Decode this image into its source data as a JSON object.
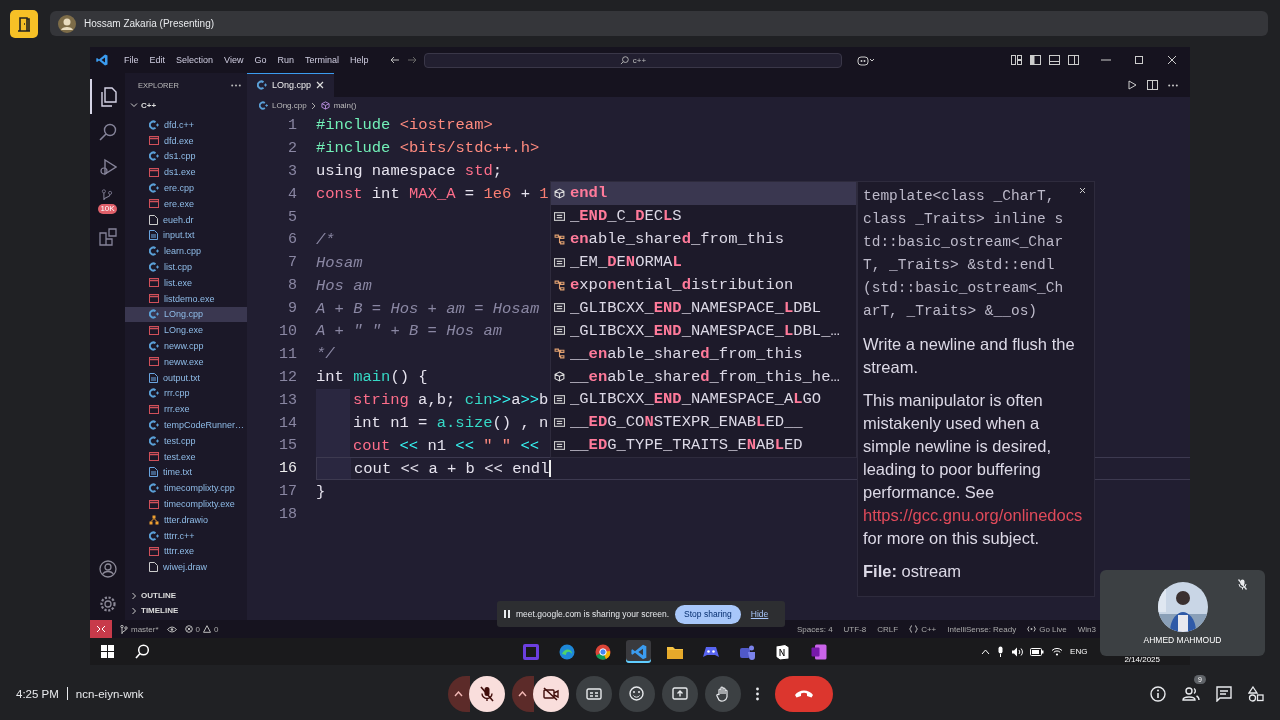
{
  "meet": {
    "presenter": "Hossam Zakaria (Presenting)",
    "time": "4:25 PM",
    "meeting_code": "ncn-eiyn-wnk",
    "controls": [
      {
        "kind": "caret"
      },
      {
        "kind": "mic",
        "on": false
      },
      {
        "kind": "caret"
      },
      {
        "kind": "camera",
        "on": false
      },
      {
        "kind": "captions"
      },
      {
        "kind": "emoji"
      },
      {
        "kind": "present"
      },
      {
        "kind": "hand"
      },
      {
        "kind": "more"
      },
      {
        "kind": "end"
      }
    ],
    "side_controls": [
      {
        "kind": "info"
      },
      {
        "kind": "people",
        "count": "9"
      },
      {
        "kind": "chat"
      },
      {
        "kind": "activities"
      }
    ]
  },
  "tile": {
    "name": "AHMED MAHMOUD",
    "muted": true
  },
  "banner": {
    "message": "meet.google.com is sharing your screen.",
    "stop": "Stop sharing",
    "hide": "Hide"
  },
  "vscode": {
    "menu": [
      "File",
      "Edit",
      "Selection",
      "View",
      "Go",
      "Run",
      "Terminal",
      "Help"
    ],
    "search": "c++",
    "activity": [
      {
        "kind": "files",
        "selected": true
      },
      {
        "kind": "search",
        "selected": false
      },
      {
        "kind": "debug",
        "selected": false
      },
      {
        "kind": "branch",
        "selected": false,
        "badge": "10K"
      },
      {
        "kind": "extensions",
        "selected": false
      }
    ],
    "explorer": {
      "title": "EXPLORER",
      "folder": "C++",
      "expanded": true,
      "files": [
        {
          "name": "dfd.c++",
          "kind": "cpp",
          "selected": false
        },
        {
          "name": "dfd.exe",
          "kind": "exe",
          "selected": false
        },
        {
          "name": "ds1.cpp",
          "kind": "cpp",
          "selected": false
        },
        {
          "name": "ds1.exe",
          "kind": "exe",
          "selected": false
        },
        {
          "name": "ere.cpp",
          "kind": "cpp",
          "selected": false
        },
        {
          "name": "ere.exe",
          "kind": "exe",
          "selected": false
        },
        {
          "name": "eueh.dr",
          "kind": "file",
          "selected": false
        },
        {
          "name": "input.txt",
          "kind": "txt",
          "selected": false
        },
        {
          "name": "learn.cpp",
          "kind": "cpp",
          "selected": false
        },
        {
          "name": "list.cpp",
          "kind": "cpp",
          "selected": false
        },
        {
          "name": "list.exe",
          "kind": "exe",
          "selected": false
        },
        {
          "name": "listdemo.exe",
          "kind": "exe",
          "selected": false
        },
        {
          "name": "LOng.cpp",
          "kind": "cpp",
          "selected": true
        },
        {
          "name": "LOng.exe",
          "kind": "exe",
          "selected": false
        },
        {
          "name": "neww.cpp",
          "kind": "cpp",
          "selected": false
        },
        {
          "name": "neww.exe",
          "kind": "exe",
          "selected": false
        },
        {
          "name": "output.txt",
          "kind": "txt",
          "selected": false
        },
        {
          "name": "rrr.cpp",
          "kind": "cpp",
          "selected": false
        },
        {
          "name": "rrr.exe",
          "kind": "exe",
          "selected": false
        },
        {
          "name": "tempCodeRunner…",
          "kind": "cpp",
          "selected": false
        },
        {
          "name": "test.cpp",
          "kind": "cpp",
          "selected": false
        },
        {
          "name": "test.exe",
          "kind": "exe",
          "selected": false
        },
        {
          "name": "time.txt",
          "kind": "txt",
          "selected": false
        },
        {
          "name": "timecomplixty.cpp",
          "kind": "cpp",
          "selected": false
        },
        {
          "name": "timecomplixty.exe",
          "kind": "exe",
          "selected": false
        },
        {
          "name": "ttter.drawio",
          "kind": "drawio",
          "selected": false
        },
        {
          "name": "tttrr.c++",
          "kind": "cpp",
          "selected": false
        },
        {
          "name": "tttrr.exe",
          "kind": "exe",
          "selected": false
        },
        {
          "name": "wiwej.draw",
          "kind": "file",
          "selected": false
        }
      ]
    },
    "sections": [
      {
        "label": "OUTLINE",
        "expanded": false
      },
      {
        "label": "TIMELINE",
        "expanded": false
      }
    ],
    "tab": {
      "label": "LOng.cpp",
      "selected": true
    },
    "breadcrumb": [
      "LOng.cpp",
      "main()"
    ],
    "lines": [
      {
        "number": "1",
        "current": false,
        "indented": false,
        "tokens": [
          {
            "text": "#include",
            "kind": "pre"
          },
          {
            "text": " <iostream>",
            "kind": "inc"
          }
        ]
      },
      {
        "number": "2",
        "current": false,
        "indented": false,
        "tokens": [
          {
            "text": "#include",
            "kind": "pre"
          },
          {
            "text": " <bits/stdc++.h>",
            "kind": "inc"
          }
        ]
      },
      {
        "number": "3",
        "current": false,
        "indented": false,
        "tokens": [
          {
            "text": "using namespace ",
            "kind": "plain"
          },
          {
            "text": "std",
            "kind": "key"
          },
          {
            "text": ";",
            "kind": "plain"
          }
        ]
      },
      {
        "number": "4",
        "current": false,
        "indented": false,
        "tokens": [
          {
            "text": "const",
            "kind": "key"
          },
          {
            "text": " int ",
            "kind": "plain"
          },
          {
            "text": "MAX_A",
            "kind": "key"
          },
          {
            "text": " = ",
            "kind": "plain"
          },
          {
            "text": "1e6",
            "kind": "num"
          },
          {
            "text": " + ",
            "kind": "plain"
          },
          {
            "text": "1",
            "kind": "num"
          }
        ]
      },
      {
        "number": "5",
        "current": false,
        "indented": false
      },
      {
        "number": "6",
        "current": false,
        "indented": false,
        "tokens": [
          {
            "text": "/*",
            "kind": "com"
          }
        ]
      },
      {
        "number": "7",
        "current": false,
        "indented": false,
        "tokens": [
          {
            "text": "Hosam",
            "kind": "com"
          }
        ]
      },
      {
        "number": "8",
        "current": false,
        "indented": false,
        "tokens": [
          {
            "text": "Hos am",
            "kind": "com"
          }
        ]
      },
      {
        "number": "9",
        "current": false,
        "indented": false,
        "tokens": [
          {
            "text": "A + B = Hos + am = Hosam",
            "kind": "com"
          }
        ]
      },
      {
        "number": "10",
        "current": false,
        "indented": false,
        "tokens": [
          {
            "text": "A + \" \" + B = Hos am",
            "kind": "com"
          }
        ]
      },
      {
        "number": "11",
        "current": false,
        "indented": false,
        "tokens": [
          {
            "text": "*/",
            "kind": "com"
          }
        ]
      },
      {
        "number": "12",
        "current": false,
        "indented": false,
        "tokens": [
          {
            "text": "int ",
            "kind": "plain"
          },
          {
            "text": "main",
            "kind": "fn"
          },
          {
            "text": "() {",
            "kind": "plain"
          }
        ]
      },
      {
        "number": "13",
        "current": false,
        "indented": true,
        "tokens": [
          {
            "text": "string",
            "kind": "key"
          },
          {
            "text": " a,b; ",
            "kind": "plain"
          },
          {
            "text": "cin",
            "kind": "fn"
          },
          {
            "text": ">>",
            "kind": "op"
          },
          {
            "text": "a",
            "kind": "plain"
          },
          {
            "text": ">>",
            "kind": "op"
          },
          {
            "text": "b",
            "kind": "plain"
          }
        ]
      },
      {
        "number": "14",
        "current": false,
        "indented": true,
        "tokens": [
          {
            "text": "int ",
            "kind": "plain"
          },
          {
            "text": "n1 = ",
            "kind": "plain"
          },
          {
            "text": "a.size",
            "kind": "fn"
          },
          {
            "text": "() , n",
            "kind": "plain"
          }
        ]
      },
      {
        "number": "15",
        "current": false,
        "indented": true,
        "tokens": [
          {
            "text": "cout",
            "kind": "key"
          },
          {
            "text": " << ",
            "kind": "op"
          },
          {
            "text": "n1",
            "kind": "plain"
          },
          {
            "text": " << ",
            "kind": "op"
          },
          {
            "text": "\" \"",
            "kind": "str"
          },
          {
            "text": " <<",
            "kind": "op"
          }
        ]
      },
      {
        "number": "16",
        "current": true,
        "indented": true,
        "tokens": [
          {
            "text": "cout << a + b << endl",
            "kind": "plain"
          }
        ]
      },
      {
        "number": "17",
        "current": false,
        "indented": false,
        "tokens": [
          {
            "text": "}",
            "kind": "plain"
          }
        ]
      },
      {
        "number": "18",
        "current": false,
        "indented": false
      }
    ],
    "suggestions": [
      {
        "label": "**endl**",
        "kind": "cube",
        "selected": true
      },
      {
        "label": "_**END**_C_**D**EC**L**S",
        "kind": "constant",
        "selected": false
      },
      {
        "label": "**en**able_share**d**_from_this",
        "kind": "class",
        "selected": false
      },
      {
        "label": "_EM_**D**E**N**ORMA**L**",
        "kind": "constant",
        "selected": false
      },
      {
        "label": "**e**xpo**n**ential_**d**istribution",
        "kind": "class",
        "selected": false
      },
      {
        "label": "_GLIBCXX_**END**_NAMESPACE_**L**DBL",
        "kind": "constant",
        "selected": false
      },
      {
        "label": "_GLIBCXX_**END**_NAMESPACE_**L**DBL_…",
        "kind": "constant",
        "selected": false
      },
      {
        "label": "__**en**able_share**d**_from_this",
        "kind": "class",
        "selected": false
      },
      {
        "label": "__**en**able_share**d**_from_this_he…",
        "kind": "cube",
        "selected": false
      },
      {
        "label": "_GLIBCXX_**END**_NAMESPACE_A**L**GO",
        "kind": "constant",
        "selected": false
      },
      {
        "label": "__**ED**G_CO**N**STEXPR_ENAB**L**ED__",
        "kind": "constant",
        "selected": false
      },
      {
        "label": "__**ED**G_TYPE_TRAITS_E**N**AB**L**ED",
        "kind": "constant",
        "selected": false
      }
    ],
    "doc": {
      "signature": "template<class _CharT, class _Traits> inline std::basic_ostream<_CharT, _Traits> &std::endl(std::basic_ostream<_CharT, _Traits> &__os)",
      "summary": "Write a newline and flush the stream.",
      "note_before": "This manipulator is often mistakenly used when a simple newline is desired, leading to poor buffering performance. See",
      "link": "https://gcc.gnu.org/onlinedocs",
      "note_after": "for more on this subject.",
      "file": "**File:** ostream"
    },
    "status": {
      "branch": "master*",
      "errors": "0",
      "warnings": "0",
      "items": [
        {
          "text": "Spaces: 4",
          "kind": "plain"
        },
        {
          "text": "UTF-8",
          "kind": "plain"
        },
        {
          "text": "CRLF",
          "kind": "plain"
        },
        {
          "text": "C++",
          "kind": "language"
        },
        {
          "text": "IntelliSense: Ready",
          "kind": "plain"
        },
        {
          "text": "Go Live",
          "kind": "live"
        },
        {
          "text": "Win3",
          "kind": "plain"
        }
      ]
    }
  },
  "taskbar": {
    "apps": [
      {
        "kind": "square",
        "selected": false
      },
      {
        "kind": "swirl",
        "selected": false
      },
      {
        "kind": "ring",
        "selected": false
      },
      {
        "kind": "ribbon",
        "selected": true
      },
      {
        "kind": "folder",
        "selected": false
      },
      {
        "kind": "controller",
        "selected": false
      },
      {
        "kind": "people",
        "selected": false
      },
      {
        "kind": "page",
        "selected": false
      },
      {
        "kind": "notebook",
        "selected": false
      }
    ],
    "language": "ENG",
    "date": "2/14/2025"
  }
}
